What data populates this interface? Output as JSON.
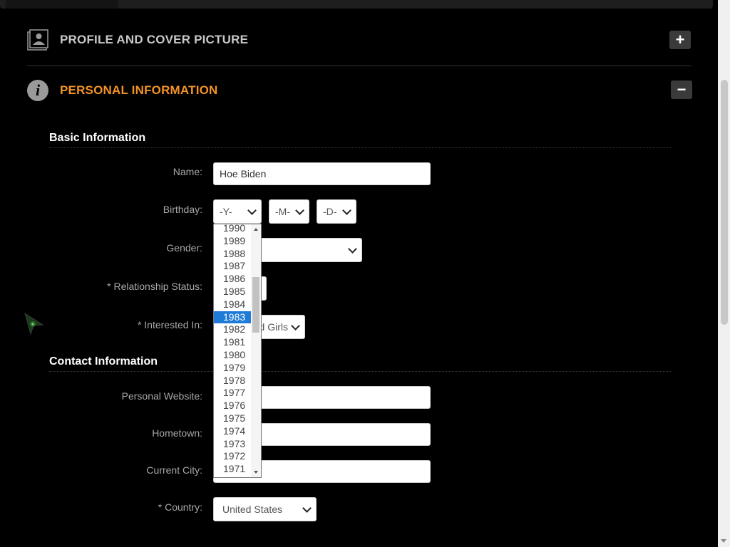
{
  "sections": {
    "profile": {
      "title": "PROFILE AND COVER PICTURE",
      "toggle": "+"
    },
    "personal": {
      "title": "PERSONAL INFORMATION",
      "toggle": "−"
    }
  },
  "basic": {
    "heading": "Basic Information",
    "name_label": "Name:",
    "name_value": "Hoe Biden",
    "birthday_label": "Birthday:",
    "year_value": "-Y-",
    "month_value": "-M-",
    "day_value": "-D-",
    "gender_label": "Gender:",
    "relationship_label": "* Relationship Status:",
    "interested_label": "* Interested In:",
    "interested_value": "d Girls"
  },
  "year_options": [
    "1990",
    "1989",
    "1988",
    "1987",
    "1986",
    "1985",
    "1984",
    "1983",
    "1982",
    "1981",
    "1980",
    "1979",
    "1978",
    "1977",
    "1976",
    "1975",
    "1974",
    "1973",
    "1972",
    "1971"
  ],
  "selected_year": "1983",
  "contact": {
    "heading": "Contact Information",
    "website_label": "Personal Website:",
    "hometown_label": "Hometown:",
    "city_label": "Current City:",
    "country_label": "* Country:",
    "country_value": "United States"
  },
  "colors": {
    "accent": "#f39325",
    "selected_option": "#1e7bd6"
  },
  "icons": {
    "profile": "profile-picture-icon",
    "info": "info-icon",
    "cursor": "arrow-cursor-icon"
  }
}
